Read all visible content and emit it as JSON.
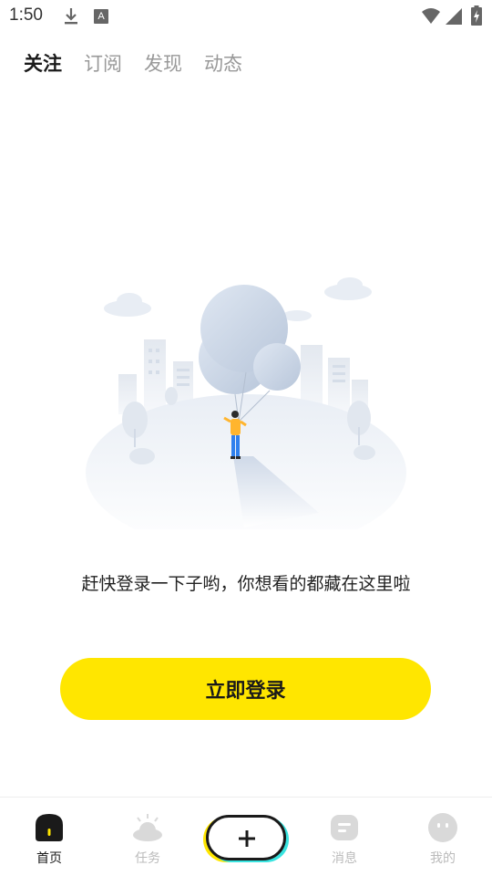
{
  "status_bar": {
    "time": "1:50",
    "notification_icon_letter": "A"
  },
  "top_tabs": [
    {
      "label": "关注",
      "active": true
    },
    {
      "label": "订阅",
      "active": false
    },
    {
      "label": "发现",
      "active": false
    },
    {
      "label": "动态",
      "active": false
    }
  ],
  "empty_state": {
    "illustration": "balloon-person-city-illustration",
    "message": "赶快登录一下子哟，你想看的都藏在这里啦"
  },
  "login_button": {
    "label": "立即登录",
    "color": "#ffe600"
  },
  "bottom_nav": {
    "items": [
      {
        "label": "首页",
        "icon": "home-icon",
        "active": true
      },
      {
        "label": "任务",
        "icon": "tasks-icon",
        "active": false
      },
      {
        "label": "消息",
        "icon": "message-icon",
        "active": false
      },
      {
        "label": "我的",
        "icon": "profile-icon",
        "active": false
      }
    ],
    "post_button_icon": "plus-icon",
    "accent_colors": [
      "#ffe600",
      "#39e4e0"
    ]
  }
}
